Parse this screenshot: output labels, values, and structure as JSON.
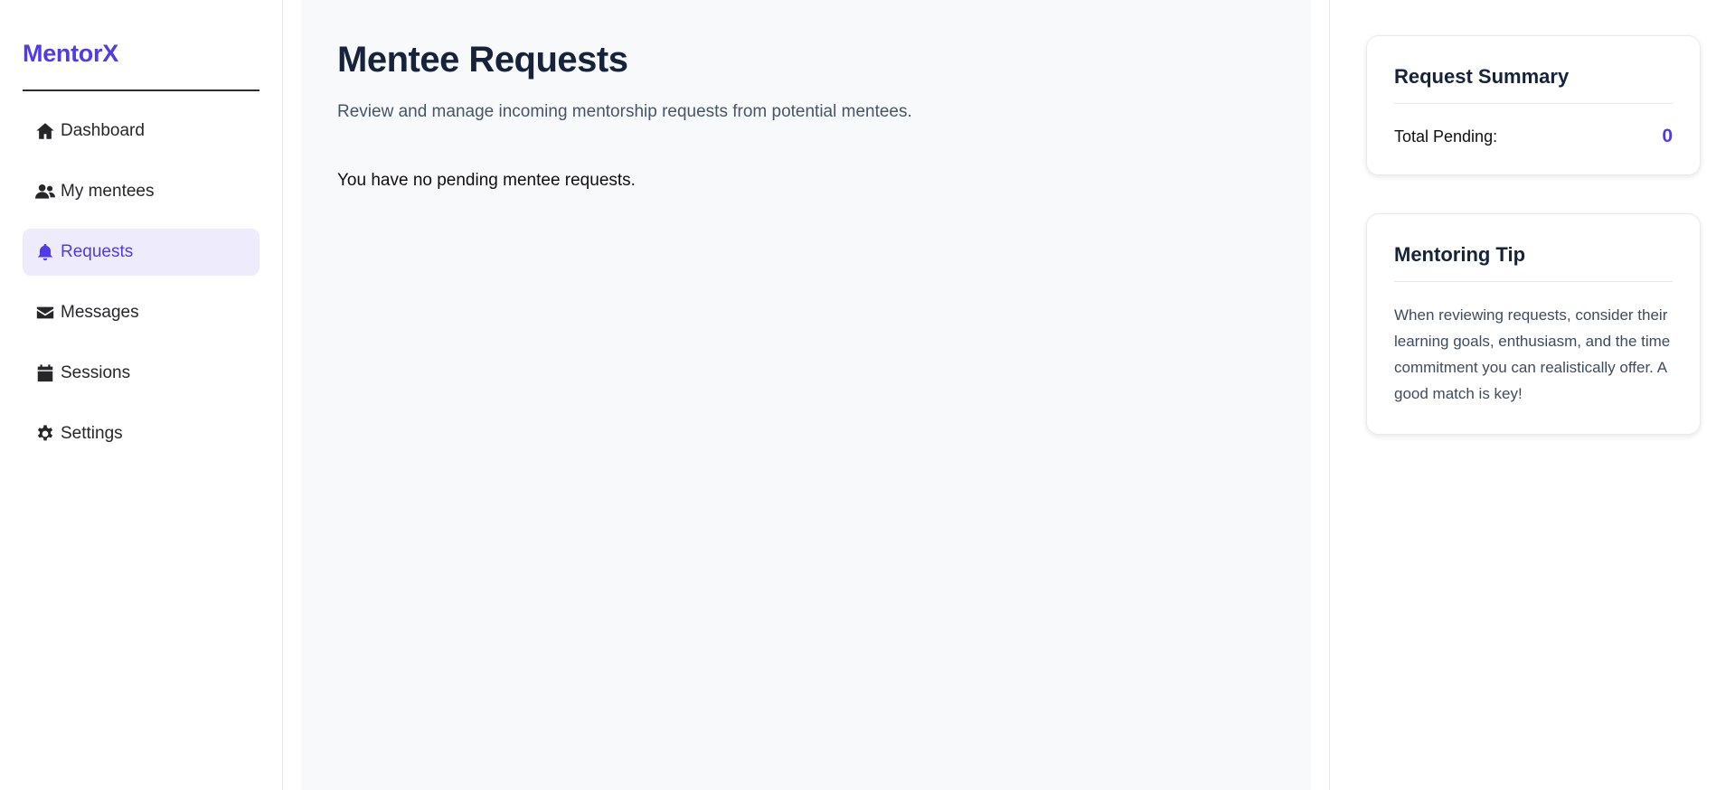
{
  "brand": "MentorX",
  "sidebar": {
    "items": [
      {
        "label": "Dashboard",
        "icon": "home-icon",
        "active": false
      },
      {
        "label": "My mentees",
        "icon": "users-icon",
        "active": false
      },
      {
        "label": "Requests",
        "icon": "bell-icon",
        "active": true
      },
      {
        "label": "Messages",
        "icon": "envelope-icon",
        "active": false
      },
      {
        "label": "Sessions",
        "icon": "calendar-icon",
        "active": false
      },
      {
        "label": "Settings",
        "icon": "gear-icon",
        "active": false
      }
    ]
  },
  "main": {
    "title": "Mentee Requests",
    "subtitle": "Review and manage incoming mentorship requests from potential mentees.",
    "empty_message": "You have no pending mentee requests."
  },
  "summary": {
    "title": "Request Summary",
    "pending_label": "Total Pending:",
    "pending_value": "0"
  },
  "tip": {
    "title": "Mentoring Tip",
    "text": "When reviewing requests, consider their learning goals, enthusiasm, and the time commitment you can realistically offer. A good match is key!"
  },
  "colors": {
    "accent": "#4f3be8",
    "active_bg": "#eeebfd",
    "main_bg": "#f8f9fb"
  }
}
